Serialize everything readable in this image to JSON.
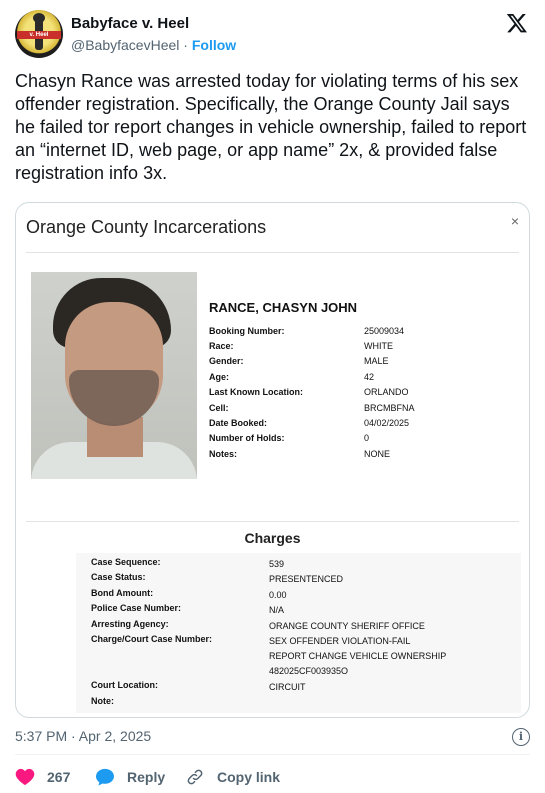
{
  "author": {
    "name": "Babyface v. Heel",
    "handle": "@BabyfacevHeel",
    "separator": "·",
    "follow_label": "Follow",
    "avatar_text": "v. Heel"
  },
  "tweet": {
    "text": "Chasyn Rance was arrested today for violating terms of his sex offender registration. Specifically, the Orange County Jail says he failed tor report changes in vehicle ownership, failed to report an “internet ID, web page, or app name” 2x, & provided false registration info 3x."
  },
  "card": {
    "title": "Orange County Incarcerations",
    "close_glyph": "×",
    "inmate_name": "RANCE, CHASYN JOHN",
    "details": [
      {
        "label": "Booking Number:",
        "value": "25009034"
      },
      {
        "label": "Race:",
        "value": "WHITE"
      },
      {
        "label": "Gender:",
        "value": "MALE"
      },
      {
        "label": "Age:",
        "value": "42"
      },
      {
        "label": "Last Known Location:",
        "value": "ORLANDO"
      },
      {
        "label": "Cell:",
        "value": "BRCMBFNA"
      },
      {
        "label": "Date Booked:",
        "value": "04/02/2025"
      },
      {
        "label": "Number of Holds:",
        "value": "0"
      },
      {
        "label": "Notes:",
        "value": "NONE"
      }
    ],
    "charges_heading": "Charges",
    "charges": [
      {
        "label": "Case Sequence:",
        "value": "539"
      },
      {
        "label": "Case Status:",
        "value": "PRESENTENCED"
      },
      {
        "label": "Bond Amount:",
        "value": "0.00"
      },
      {
        "label": "Police Case Number:",
        "value": "N/A"
      },
      {
        "label": "Arresting Agency:",
        "value": "ORANGE COUNTY SHERIFF OFFICE"
      },
      {
        "label": "Charge/Court Case Number:",
        "value": "SEX OFFENDER VIOLATION-FAIL"
      },
      {
        "label": "",
        "value": "REPORT CHANGE VEHICLE OWNERSHIP"
      },
      {
        "label": "",
        "value": "482025CF003935O"
      },
      {
        "label": "Court Location:",
        "value": "CIRCUIT"
      },
      {
        "label": "Note:",
        "value": ""
      }
    ]
  },
  "meta": {
    "timestamp": "5:37 PM · Apr 2, 2025"
  },
  "actions": {
    "likes_count": "267",
    "reply_label": "Reply",
    "copy_label": "Copy link"
  },
  "icons": {
    "x_logo": "x-logo-icon",
    "info": "info-icon",
    "heart": "heart-icon",
    "reply": "speech-bubble-icon",
    "copy": "link-icon"
  },
  "colors": {
    "accent": "#1d9bf0",
    "like": "#f91880",
    "muted": "#536471"
  }
}
